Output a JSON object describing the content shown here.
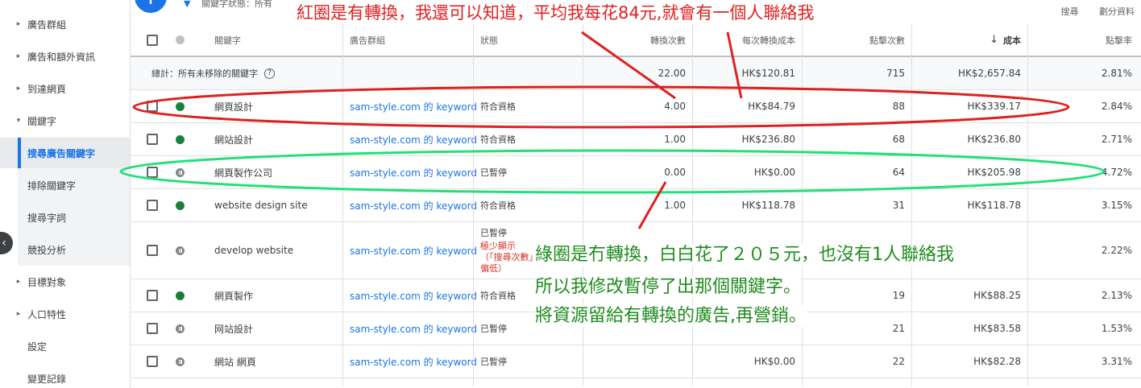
{
  "sidebar": {
    "items": [
      {
        "label": "廣告群組",
        "caret": "▸"
      },
      {
        "label": "廣告和額外資訊",
        "caret": "▸"
      },
      {
        "label": "到達網頁",
        "caret": "▸"
      },
      {
        "label": "關鍵字",
        "caret": "▾"
      },
      {
        "label": "搜尋廣告關鍵字",
        "caret": ""
      },
      {
        "label": "排除關鍵字",
        "caret": ""
      },
      {
        "label": "搜尋字詞",
        "caret": ""
      },
      {
        "label": "競投分析",
        "caret": ""
      },
      {
        "label": "目標對象",
        "caret": "▸"
      },
      {
        "label": "人口特性",
        "caret": "▸"
      },
      {
        "label": "設定",
        "caret": ""
      },
      {
        "label": "變更記錄",
        "caret": ""
      }
    ],
    "collapse_glyph": "‹"
  },
  "toolbar": {
    "add_glyph": "+",
    "filter_icon": "▼",
    "filter_text": "關鍵字狀態：所有",
    "search_label": "搜尋",
    "segment_label": "劃分資料"
  },
  "table": {
    "headers": {
      "keyword": "關鍵字",
      "ad_group": "廣告群組",
      "status": "狀態",
      "conversions": "轉換次數",
      "cost_per_conv": "每次轉換成本",
      "clicks": "點擊次數",
      "cost": "成本",
      "sort_arrow": "↓",
      "ctr": "點擊率"
    },
    "total": {
      "label": "總計：所有未移除的關鍵字",
      "help_icon": "?",
      "conversions": "22.00",
      "cost_per_conv": "HK$120.81",
      "clicks": "715",
      "cost": "HK$2,657.84",
      "ctr": "2.81%"
    },
    "rows": [
      {
        "status_dot": "enabled",
        "keyword": "網頁設計",
        "ad_group": "sam-style.com 的 keyword",
        "status": "符合資格",
        "warning": "",
        "conversions": "4.00",
        "cost_per_conv": "HK$84.79",
        "clicks": "88",
        "cost": "HK$339.17",
        "ctr": "2.84%"
      },
      {
        "status_dot": "enabled",
        "keyword": "網站設計",
        "ad_group": "sam-style.com 的 keyword",
        "status": "符合資格",
        "warning": "",
        "conversions": "1.00",
        "cost_per_conv": "HK$236.80",
        "clicks": "68",
        "cost": "HK$236.80",
        "ctr": "2.71%"
      },
      {
        "status_dot": "paused",
        "keyword": "網頁製作公司",
        "ad_group": "sam-style.com 的 keyword",
        "status": "已暫停",
        "warning": "",
        "conversions": "0.00",
        "cost_per_conv": "HK$0.00",
        "clicks": "64",
        "cost": "HK$205.98",
        "ctr": "4.72%"
      },
      {
        "status_dot": "enabled",
        "keyword": "website design site",
        "ad_group": "sam-style.com 的 keyword",
        "status": "符合資格",
        "warning": "",
        "conversions": "1.00",
        "cost_per_conv": "HK$118.78",
        "clicks": "31",
        "cost": "HK$118.78",
        "ctr": "3.15%"
      },
      {
        "status_dot": "paused",
        "keyword": "develop website",
        "ad_group": "sam-style.com 的 keyword",
        "status": "已暫停",
        "warning": "極少顯示（「搜尋次數」偏低）",
        "conversions": "",
        "cost_per_conv": "",
        "clicks": "",
        "cost": "",
        "ctr": "2.22%"
      },
      {
        "status_dot": "enabled",
        "keyword": "網頁製作",
        "ad_group": "sam-style.com 的 keyword",
        "status": "符合資格",
        "warning": "",
        "conversions": "",
        "cost_per_conv": "",
        "clicks": "19",
        "cost": "HK$88.25",
        "ctr": "2.13%"
      },
      {
        "status_dot": "paused",
        "keyword": "网站設計",
        "ad_group": "sam-style.com 的 keyword",
        "status": "已暫停",
        "warning": "",
        "conversions": "",
        "cost_per_conv": "",
        "clicks": "21",
        "cost": "HK$83.58",
        "ctr": "1.53%"
      },
      {
        "status_dot": "paused",
        "keyword": "網站 網頁",
        "ad_group": "sam-style.com 的 keyword",
        "status": "已暫停",
        "warning": "",
        "conversions": "",
        "cost_per_conv": "HK$0.00",
        "clicks": "22",
        "cost": "HK$82.28",
        "ctr": "3.31%"
      }
    ]
  },
  "annotations": {
    "red_text": "紅圈是有轉換，我還可以知道，平均我每花84元,就會有一個人聯絡我",
    "green_line1": "綠圈是冇轉換，白白花了２０５元，也沒有1人聯絡我",
    "green_line2": "所以我修改暫停了出那個關鍵字。",
    "green_line3": "將資源留給有轉換的廣告,再營銷。",
    "red_color": "#e02020",
    "green_color": "#1e8c1e",
    "green_circle_color": "#22e07a"
  }
}
